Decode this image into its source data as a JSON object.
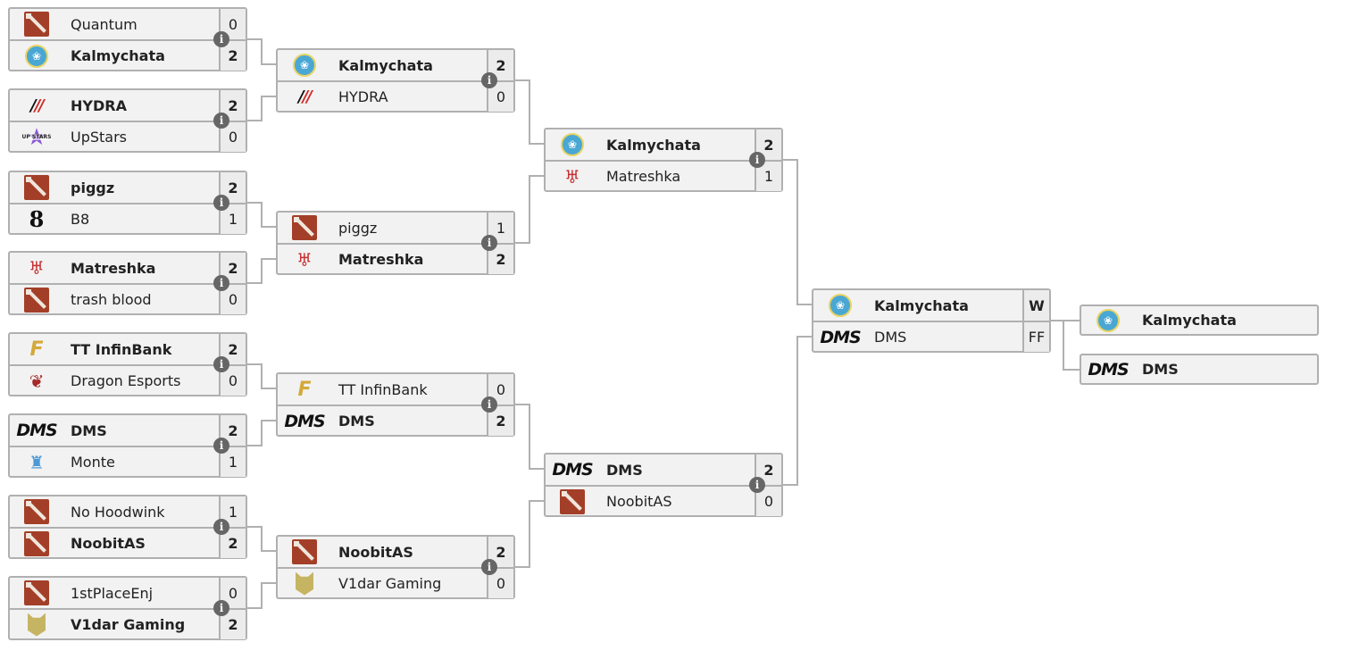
{
  "bracket": {
    "rounds": [
      {
        "name": "round-1",
        "matches": [
          {
            "team1": {
              "name": "Quantum",
              "logo": "dota-icon",
              "score": "0",
              "winner": false
            },
            "team2": {
              "name": "Kalmychata",
              "logo": "kalmychata-logo",
              "score": "2",
              "winner": true
            }
          },
          {
            "team1": {
              "name": "HYDRA",
              "logo": "hydra-logo",
              "score": "2",
              "winner": true
            },
            "team2": {
              "name": "UpStars",
              "logo": "upstars-logo",
              "score": "0",
              "winner": false
            }
          },
          {
            "team1": {
              "name": "piggz",
              "logo": "dota-icon",
              "score": "2",
              "winner": true
            },
            "team2": {
              "name": "B8",
              "logo": "b8-logo",
              "score": "1",
              "winner": false
            }
          },
          {
            "team1": {
              "name": "Matreshka",
              "logo": "matreshka-logo",
              "score": "2",
              "winner": true
            },
            "team2": {
              "name": "trash blood",
              "logo": "dota-icon",
              "score": "0",
              "winner": false
            }
          },
          {
            "team1": {
              "name": "TT InfinBank",
              "logo": "tt-infinbank-logo",
              "score": "2",
              "winner": true
            },
            "team2": {
              "name": "Dragon Esports",
              "logo": "dragon-esports-logo",
              "score": "0",
              "winner": false
            }
          },
          {
            "team1": {
              "name": "DMS",
              "logo": "dms-logo",
              "score": "2",
              "winner": true
            },
            "team2": {
              "name": "Monte",
              "logo": "monte-logo",
              "score": "1",
              "winner": false
            }
          },
          {
            "team1": {
              "name": "No Hoodwink",
              "logo": "dota-icon",
              "score": "1",
              "winner": false
            },
            "team2": {
              "name": "NoobitAS",
              "logo": "dota-icon",
              "score": "2",
              "winner": true
            }
          },
          {
            "team1": {
              "name": "1stPlaceEnj",
              "logo": "dota-icon",
              "score": "0",
              "winner": false
            },
            "team2": {
              "name": "V1dar Gaming",
              "logo": "v1dar-logo",
              "score": "2",
              "winner": true
            }
          }
        ]
      },
      {
        "name": "round-2",
        "matches": [
          {
            "team1": {
              "name": "Kalmychata",
              "logo": "kalmychata-logo",
              "score": "2",
              "winner": true
            },
            "team2": {
              "name": "HYDRA",
              "logo": "hydra-logo",
              "score": "0",
              "winner": false
            }
          },
          {
            "team1": {
              "name": "piggz",
              "logo": "dota-icon",
              "score": "1",
              "winner": false
            },
            "team2": {
              "name": "Matreshka",
              "logo": "matreshka-logo",
              "score": "2",
              "winner": true
            }
          },
          {
            "team1": {
              "name": "TT InfinBank",
              "logo": "tt-infinbank-logo",
              "score": "0",
              "winner": false
            },
            "team2": {
              "name": "DMS",
              "logo": "dms-logo",
              "score": "2",
              "winner": true
            }
          },
          {
            "team1": {
              "name": "NoobitAS",
              "logo": "dota-icon",
              "score": "2",
              "winner": true
            },
            "team2": {
              "name": "V1dar Gaming",
              "logo": "v1dar-logo",
              "score": "0",
              "winner": false
            }
          }
        ]
      },
      {
        "name": "round-3",
        "matches": [
          {
            "team1": {
              "name": "Kalmychata",
              "logo": "kalmychata-logo",
              "score": "2",
              "winner": true
            },
            "team2": {
              "name": "Matreshka",
              "logo": "matreshka-logo",
              "score": "1",
              "winner": false
            }
          },
          {
            "team1": {
              "name": "DMS",
              "logo": "dms-logo",
              "score": "2",
              "winner": true
            },
            "team2": {
              "name": "NoobitAS",
              "logo": "dota-icon",
              "score": "0",
              "winner": false
            }
          }
        ]
      },
      {
        "name": "final",
        "matches": [
          {
            "team1": {
              "name": "Kalmychata",
              "logo": "kalmychata-logo",
              "score": "W",
              "winner": true
            },
            "team2": {
              "name": "DMS",
              "logo": "dms-logo",
              "score": "FF",
              "winner": false
            },
            "no_info": true
          }
        ]
      }
    ],
    "placements": [
      {
        "name": "Kalmychata",
        "logo": "kalmychata-logo"
      },
      {
        "name": "DMS",
        "logo": "dms-logo"
      }
    ],
    "info_icon_glyph": "i",
    "logo_text": {
      "dms": "DMS",
      "hydra_b": "/",
      "hydra_r": "/",
      "upstars": "UP STARS",
      "b8": "8",
      "star": "★",
      "lotus": "❀",
      "matreshka": "♅",
      "tt": "F",
      "dragon": "❦",
      "monte": "♜"
    }
  }
}
